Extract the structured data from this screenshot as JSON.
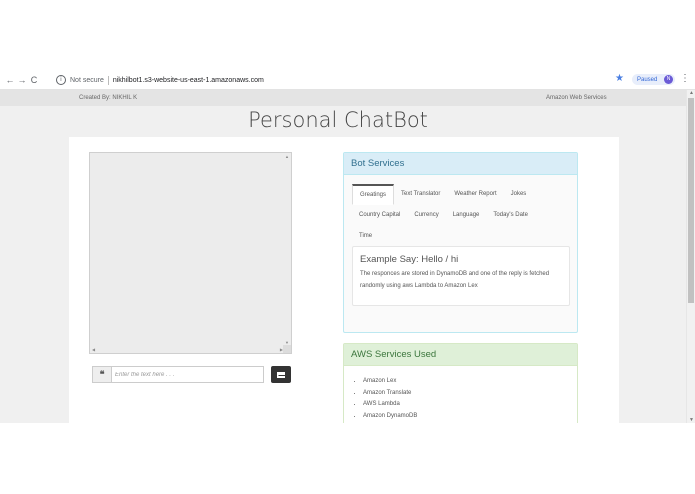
{
  "browser": {
    "security_label": "Not secure",
    "url": "nikhilbot1.s3-website-us-east-1.amazonaws.com",
    "profile_status": "Paused",
    "profile_initial": "N",
    "info_glyph": "i",
    "back_glyph": "←",
    "forward_glyph": "→",
    "reload_glyph": "C",
    "star_glyph": "★",
    "menu_glyph": "⋮"
  },
  "topnav": {
    "creator": "Created By: NIKHIL K",
    "link": "Amazon Web Services"
  },
  "page": {
    "title": "Personal ChatBot"
  },
  "chat": {
    "input_placeholder": "Enter the text here . . .",
    "input_value": "",
    "quote_glyph": "❝"
  },
  "bot_services": {
    "heading": "Bot Services",
    "tab_rows": [
      [
        "Greatings",
        "Text Translator",
        "Weather Report",
        "Jokes"
      ],
      [
        "Country Capital",
        "Currency",
        "Language",
        "Today's Date"
      ],
      [
        "Time"
      ]
    ],
    "active_tab": "Greatings",
    "example_title": "Example Say: Hello / hi",
    "example_description": "The responces are stored in DynamoDB and one of the reply is fetched randomly using aws Lambda to Amazon Lex"
  },
  "aws_services": {
    "heading": "AWS Services Used",
    "items": [
      "Amazon Lex",
      "Amazon Translate",
      "AWS Lambda",
      "Amazon DynamoDB"
    ]
  }
}
